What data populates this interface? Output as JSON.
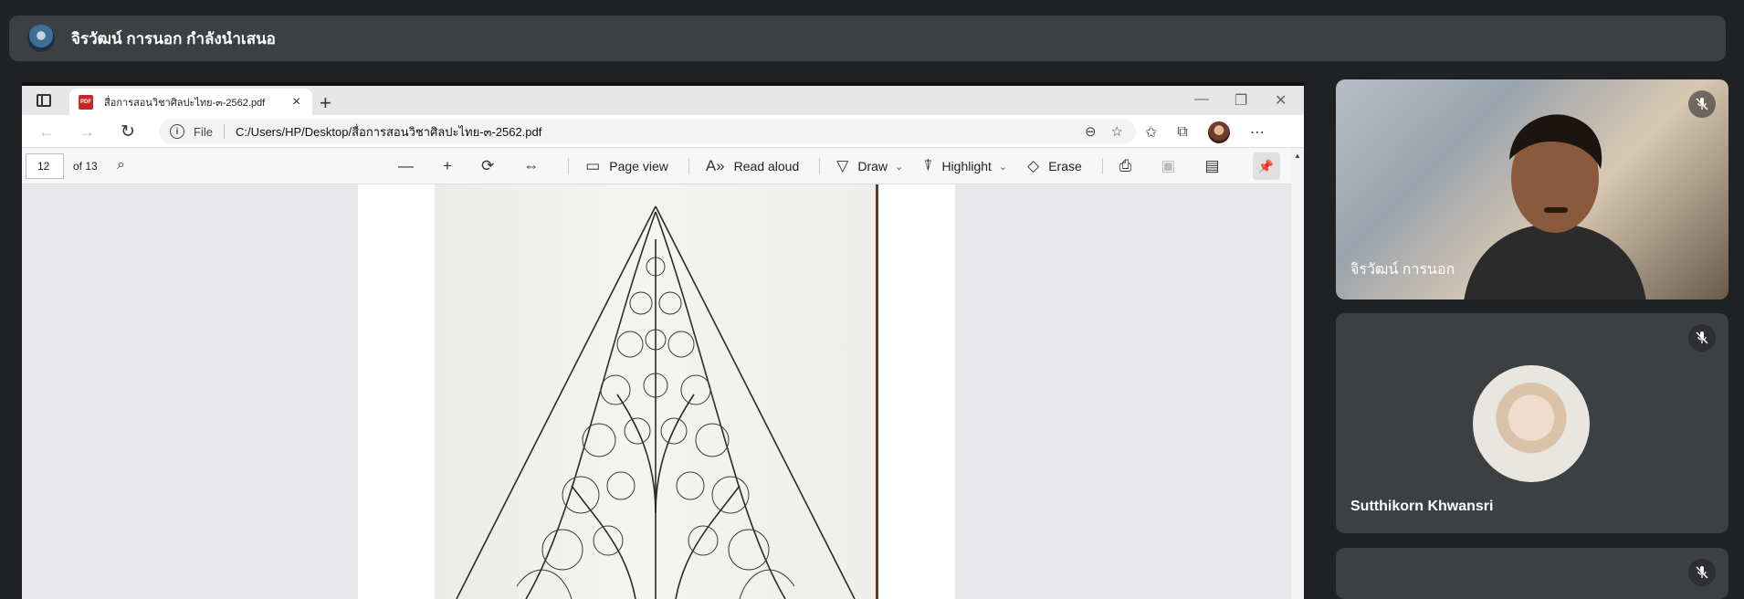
{
  "banner": {
    "presenter_text": "จิรวัฒน์ การนอก กำลังนำเสนอ"
  },
  "browser": {
    "tab_title": "สื่อการสอนวิชาศิลปะไทย-๓-2562.pdf",
    "file_label": "File",
    "url": "C:/Users/HP/Desktop/สื่อการสอนวิชาศิลปะไทย-๓-2562.pdf"
  },
  "pdf_toolbar": {
    "page_number": "12",
    "page_total": "of 13",
    "page_view_label": "Page view",
    "read_aloud_label": "Read aloud",
    "draw_label": "Draw",
    "highlight_label": "Highlight",
    "erase_label": "Erase"
  },
  "participants": [
    {
      "name": "จิรวัฒน์ การนอก",
      "muted": true
    },
    {
      "name": "Sutthikorn Khwansri",
      "muted": true
    },
    {
      "name": "",
      "muted": true
    }
  ]
}
